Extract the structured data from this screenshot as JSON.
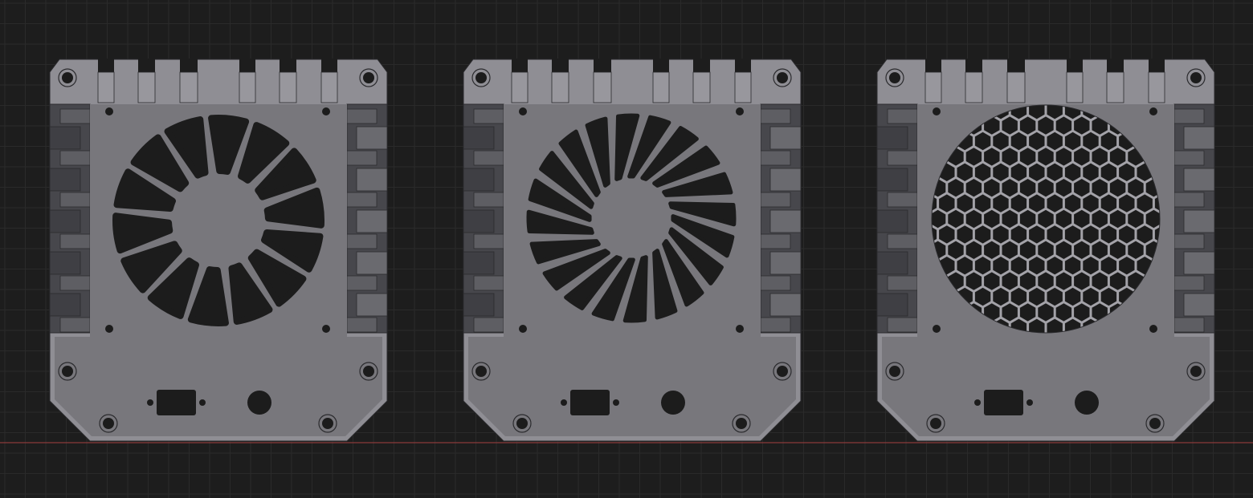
{
  "viewport": {
    "background": "#1d1d1d",
    "grid_color": "#2a2a2a",
    "axis_line_color": "#8a3b3b"
  },
  "colors": {
    "plate": "#78777c",
    "plate_edge": "#8f8e94",
    "fin_dark": "#47474c",
    "fin_light": "#5e5e63",
    "hole": "#1c1c1c",
    "outline": "#2b2b2e"
  },
  "panels": [
    {
      "vent_style": "curved-slots-14",
      "vent_count": 14
    },
    {
      "vent_style": "swirl-slots-20",
      "vent_count": 20
    },
    {
      "vent_style": "hexagon-mesh"
    }
  ]
}
